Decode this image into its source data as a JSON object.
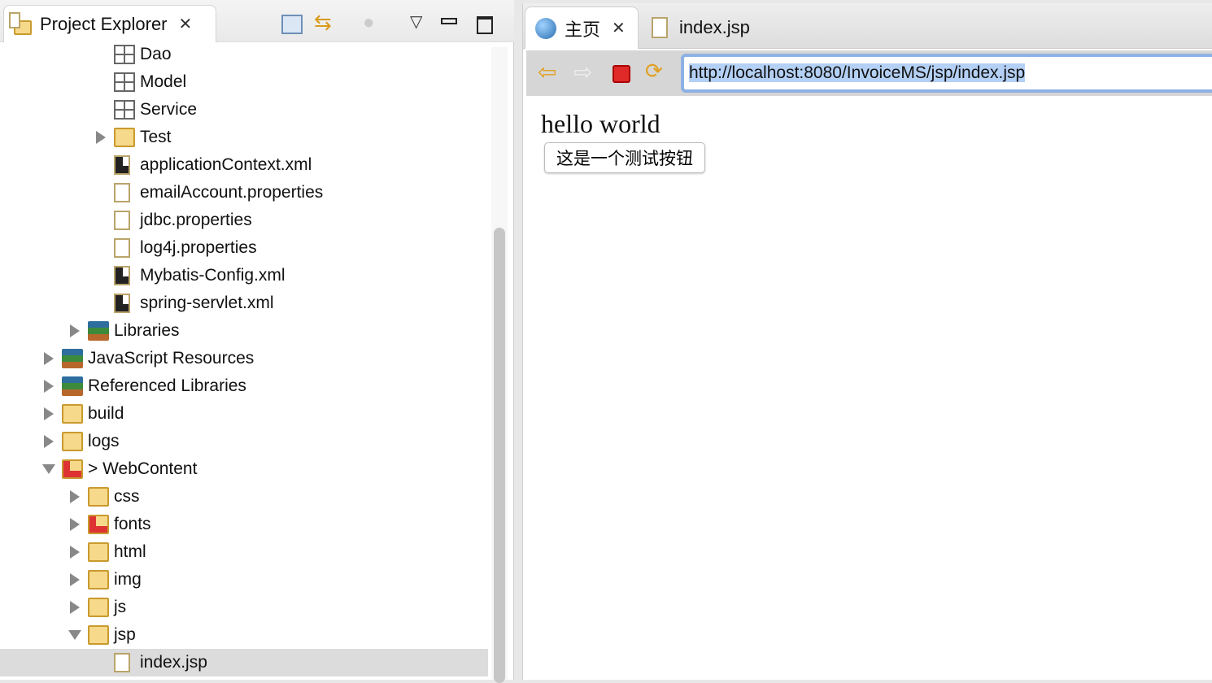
{
  "explorer": {
    "title": "Project Explorer",
    "toolbar": [
      "collapse-all-icon",
      "link-with-editor-icon",
      "filter-icon",
      "view-menu-icon",
      "minimize-icon",
      "maximize-icon"
    ],
    "items": [
      {
        "label": "Dao",
        "level": 4,
        "icon": "package",
        "arrow": "none"
      },
      {
        "label": "Model",
        "level": 4,
        "icon": "package",
        "arrow": "none"
      },
      {
        "label": "Service",
        "level": 4,
        "icon": "package",
        "arrow": "none"
      },
      {
        "label": "Test",
        "level": 4,
        "icon": "package-folder",
        "arrow": "right"
      },
      {
        "label": "applicationContext.xml",
        "level": 4,
        "icon": "xml-file",
        "arrow": "none"
      },
      {
        "label": "emailAccount.properties",
        "level": 4,
        "icon": "properties-file",
        "arrow": "none"
      },
      {
        "label": "jdbc.properties",
        "level": 4,
        "icon": "properties-file",
        "arrow": "none"
      },
      {
        "label": "log4j.properties",
        "level": 4,
        "icon": "properties-file",
        "arrow": "none"
      },
      {
        "label": "Mybatis-Config.xml",
        "level": 4,
        "icon": "xml-file",
        "arrow": "none"
      },
      {
        "label": "spring-servlet.xml",
        "level": 4,
        "icon": "xml-file",
        "arrow": "none"
      },
      {
        "label": "Libraries",
        "level": 3,
        "icon": "library",
        "arrow": "right"
      },
      {
        "label": "JavaScript Resources",
        "level": 2,
        "icon": "library",
        "arrow": "right"
      },
      {
        "label": "Referenced Libraries",
        "level": 2,
        "icon": "library",
        "arrow": "right"
      },
      {
        "label": "build",
        "level": 2,
        "icon": "folder",
        "arrow": "right"
      },
      {
        "label": "logs",
        "level": 2,
        "icon": "folder",
        "arrow": "right"
      },
      {
        "label": "> WebContent",
        "level": 2,
        "icon": "folder-error",
        "arrow": "down"
      },
      {
        "label": "css",
        "level": 3,
        "icon": "folder",
        "arrow": "right"
      },
      {
        "label": "fonts",
        "level": 3,
        "icon": "folder-error",
        "arrow": "right"
      },
      {
        "label": "html",
        "level": 3,
        "icon": "folder",
        "arrow": "right"
      },
      {
        "label": "img",
        "level": 3,
        "icon": "folder",
        "arrow": "right"
      },
      {
        "label": "js",
        "level": 3,
        "icon": "folder",
        "arrow": "right"
      },
      {
        "label": "jsp",
        "level": 3,
        "icon": "folder",
        "arrow": "down"
      },
      {
        "label": "index.jsp",
        "level": 4,
        "icon": "jsp-file",
        "arrow": "none",
        "selected": true
      }
    ]
  },
  "editor": {
    "tabs": [
      {
        "label": "主页",
        "icon": "globe-icon",
        "active": true
      },
      {
        "label": "index.jsp",
        "icon": "jsp-file-icon",
        "active": false
      }
    ],
    "url": "http://localhost:8080/InvoiceMS/jsp/index.jsp",
    "page": {
      "text": "hello world",
      "button": "这是一个测试按钮"
    }
  }
}
